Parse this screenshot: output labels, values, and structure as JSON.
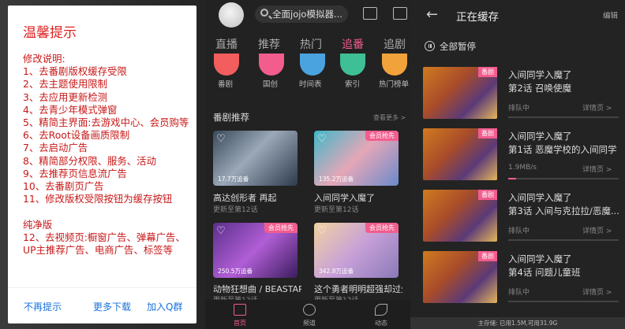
{
  "dialog": {
    "title": "温馨提示",
    "body": "修改说明:\n1、去番剧版权缓存受限\n2、去主题使用限制\n3、去应用更新检测\n4、去青少年模式弹窗\n5、精简主界面:去游戏中心、会员购等\n6、去Root设备画质限制\n7、去启动广告\n8、精简部分权限、服务、活动\n9、去推荐页信息流广告\n10、去番剧页广告\n11、修改版权受限按钮为缓存按钮\n\n纯净版\n12、去视频页:橱窗广告、弹幕广告、UP主推荐广告、电商广告、标签等",
    "buttons": [
      "不再提示",
      "更多下载",
      "加入Q群"
    ]
  },
  "middle": {
    "search_placeholder": "全面jojo模拟器...",
    "tabs": [
      "直播",
      "推荐",
      "热门",
      "追番",
      "追剧"
    ],
    "active_tab": "追番",
    "categories": [
      {
        "label": "番剧",
        "color": "#f25d5d"
      },
      {
        "label": "国创",
        "color": "#f25d8e"
      },
      {
        "label": "时间表",
        "color": "#4aa3df"
      },
      {
        "label": "索引",
        "color": "#3fbf95"
      },
      {
        "label": "热门榜单",
        "color": "#f2a23a"
      }
    ],
    "section_title": "番剧推荐",
    "section_more": "查看更多 >",
    "cards": [
      {
        "title": "高达创形者 再起",
        "subtitle": "更新至第12话",
        "views": "17.7万追番",
        "badge": "",
        "bg": "linear-gradient(135deg,#3a4a5a,#9aa8b8 45%,#2c3a4c)"
      },
      {
        "title": "入间同学入魔了",
        "subtitle": "更新至第12话",
        "views": "135.2万追番",
        "badge": "会员抢先",
        "bg": "linear-gradient(135deg,#3fb8c9,#e5a7b8 50%,#6a8acb)"
      },
      {
        "title": "动物狂想曲 / BEASTARS",
        "subtitle": "更新至第12话",
        "views": "250.5万追番",
        "badge": "会员抢先",
        "bg": "linear-gradient(135deg,#5a2f8a,#b15ed6 50%,#3a1d5e)"
      },
      {
        "title": "这个勇者明明超强却过分慎重",
        "subtitle": "更新至第12话",
        "views": "342.8万追番",
        "badge": "会员抢先",
        "bg": "linear-gradient(135deg,#f0d2a0,#c8a0d8 50%,#8a7ab8)"
      }
    ],
    "nav": [
      "首页",
      "频道",
      "动态"
    ],
    "nav_active": "首页"
  },
  "right": {
    "title": "正在缓存",
    "edit": "编辑",
    "pause_all": "全部暂停",
    "badge": "番剧",
    "detail": "详情页 >",
    "items": [
      {
        "title": "入间同学入魔了",
        "episode": "第2话 召唤使魔",
        "status": "排队中",
        "progress": 0
      },
      {
        "title": "入间同学入魔了",
        "episode": "第1话 恶魔学校的入间同学",
        "status": "1.9MB/s",
        "progress": 0.07
      },
      {
        "title": "入间同学入魔了",
        "episode": "第3话 入间与克拉拉/恶魔...",
        "status": "排队中",
        "progress": 0
      },
      {
        "title": "入间同学入魔了",
        "episode": "第4话 问题儿童班",
        "status": "排队中",
        "progress": 0
      }
    ],
    "storage": "主存储: 已用1.5M,可用31.9G"
  }
}
